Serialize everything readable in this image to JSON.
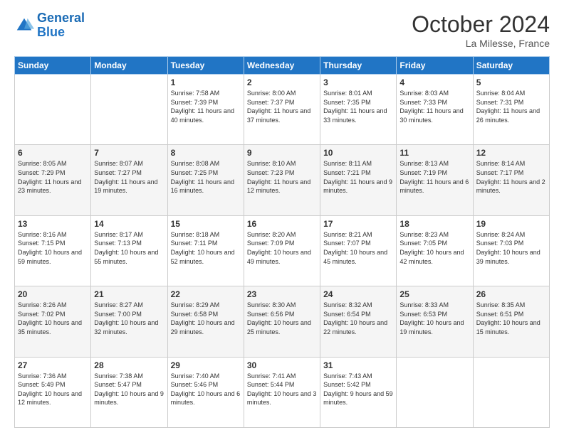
{
  "logo": {
    "line1": "General",
    "line2": "Blue"
  },
  "header": {
    "month": "October 2024",
    "location": "La Milesse, France"
  },
  "days_of_week": [
    "Sunday",
    "Monday",
    "Tuesday",
    "Wednesday",
    "Thursday",
    "Friday",
    "Saturday"
  ],
  "weeks": [
    [
      {
        "day": "",
        "sunrise": "",
        "sunset": "",
        "daylight": ""
      },
      {
        "day": "",
        "sunrise": "",
        "sunset": "",
        "daylight": ""
      },
      {
        "day": "1",
        "sunrise": "Sunrise: 7:58 AM",
        "sunset": "Sunset: 7:39 PM",
        "daylight": "Daylight: 11 hours and 40 minutes."
      },
      {
        "day": "2",
        "sunrise": "Sunrise: 8:00 AM",
        "sunset": "Sunset: 7:37 PM",
        "daylight": "Daylight: 11 hours and 37 minutes."
      },
      {
        "day": "3",
        "sunrise": "Sunrise: 8:01 AM",
        "sunset": "Sunset: 7:35 PM",
        "daylight": "Daylight: 11 hours and 33 minutes."
      },
      {
        "day": "4",
        "sunrise": "Sunrise: 8:03 AM",
        "sunset": "Sunset: 7:33 PM",
        "daylight": "Daylight: 11 hours and 30 minutes."
      },
      {
        "day": "5",
        "sunrise": "Sunrise: 8:04 AM",
        "sunset": "Sunset: 7:31 PM",
        "daylight": "Daylight: 11 hours and 26 minutes."
      }
    ],
    [
      {
        "day": "6",
        "sunrise": "Sunrise: 8:05 AM",
        "sunset": "Sunset: 7:29 PM",
        "daylight": "Daylight: 11 hours and 23 minutes."
      },
      {
        "day": "7",
        "sunrise": "Sunrise: 8:07 AM",
        "sunset": "Sunset: 7:27 PM",
        "daylight": "Daylight: 11 hours and 19 minutes."
      },
      {
        "day": "8",
        "sunrise": "Sunrise: 8:08 AM",
        "sunset": "Sunset: 7:25 PM",
        "daylight": "Daylight: 11 hours and 16 minutes."
      },
      {
        "day": "9",
        "sunrise": "Sunrise: 8:10 AM",
        "sunset": "Sunset: 7:23 PM",
        "daylight": "Daylight: 11 hours and 12 minutes."
      },
      {
        "day": "10",
        "sunrise": "Sunrise: 8:11 AM",
        "sunset": "Sunset: 7:21 PM",
        "daylight": "Daylight: 11 hours and 9 minutes."
      },
      {
        "day": "11",
        "sunrise": "Sunrise: 8:13 AM",
        "sunset": "Sunset: 7:19 PM",
        "daylight": "Daylight: 11 hours and 6 minutes."
      },
      {
        "day": "12",
        "sunrise": "Sunrise: 8:14 AM",
        "sunset": "Sunset: 7:17 PM",
        "daylight": "Daylight: 11 hours and 2 minutes."
      }
    ],
    [
      {
        "day": "13",
        "sunrise": "Sunrise: 8:16 AM",
        "sunset": "Sunset: 7:15 PM",
        "daylight": "Daylight: 10 hours and 59 minutes."
      },
      {
        "day": "14",
        "sunrise": "Sunrise: 8:17 AM",
        "sunset": "Sunset: 7:13 PM",
        "daylight": "Daylight: 10 hours and 55 minutes."
      },
      {
        "day": "15",
        "sunrise": "Sunrise: 8:18 AM",
        "sunset": "Sunset: 7:11 PM",
        "daylight": "Daylight: 10 hours and 52 minutes."
      },
      {
        "day": "16",
        "sunrise": "Sunrise: 8:20 AM",
        "sunset": "Sunset: 7:09 PM",
        "daylight": "Daylight: 10 hours and 49 minutes."
      },
      {
        "day": "17",
        "sunrise": "Sunrise: 8:21 AM",
        "sunset": "Sunset: 7:07 PM",
        "daylight": "Daylight: 10 hours and 45 minutes."
      },
      {
        "day": "18",
        "sunrise": "Sunrise: 8:23 AM",
        "sunset": "Sunset: 7:05 PM",
        "daylight": "Daylight: 10 hours and 42 minutes."
      },
      {
        "day": "19",
        "sunrise": "Sunrise: 8:24 AM",
        "sunset": "Sunset: 7:03 PM",
        "daylight": "Daylight: 10 hours and 39 minutes."
      }
    ],
    [
      {
        "day": "20",
        "sunrise": "Sunrise: 8:26 AM",
        "sunset": "Sunset: 7:02 PM",
        "daylight": "Daylight: 10 hours and 35 minutes."
      },
      {
        "day": "21",
        "sunrise": "Sunrise: 8:27 AM",
        "sunset": "Sunset: 7:00 PM",
        "daylight": "Daylight: 10 hours and 32 minutes."
      },
      {
        "day": "22",
        "sunrise": "Sunrise: 8:29 AM",
        "sunset": "Sunset: 6:58 PM",
        "daylight": "Daylight: 10 hours and 29 minutes."
      },
      {
        "day": "23",
        "sunrise": "Sunrise: 8:30 AM",
        "sunset": "Sunset: 6:56 PM",
        "daylight": "Daylight: 10 hours and 25 minutes."
      },
      {
        "day": "24",
        "sunrise": "Sunrise: 8:32 AM",
        "sunset": "Sunset: 6:54 PM",
        "daylight": "Daylight: 10 hours and 22 minutes."
      },
      {
        "day": "25",
        "sunrise": "Sunrise: 8:33 AM",
        "sunset": "Sunset: 6:53 PM",
        "daylight": "Daylight: 10 hours and 19 minutes."
      },
      {
        "day": "26",
        "sunrise": "Sunrise: 8:35 AM",
        "sunset": "Sunset: 6:51 PM",
        "daylight": "Daylight: 10 hours and 15 minutes."
      }
    ],
    [
      {
        "day": "27",
        "sunrise": "Sunrise: 7:36 AM",
        "sunset": "Sunset: 5:49 PM",
        "daylight": "Daylight: 10 hours and 12 minutes."
      },
      {
        "day": "28",
        "sunrise": "Sunrise: 7:38 AM",
        "sunset": "Sunset: 5:47 PM",
        "daylight": "Daylight: 10 hours and 9 minutes."
      },
      {
        "day": "29",
        "sunrise": "Sunrise: 7:40 AM",
        "sunset": "Sunset: 5:46 PM",
        "daylight": "Daylight: 10 hours and 6 minutes."
      },
      {
        "day": "30",
        "sunrise": "Sunrise: 7:41 AM",
        "sunset": "Sunset: 5:44 PM",
        "daylight": "Daylight: 10 hours and 3 minutes."
      },
      {
        "day": "31",
        "sunrise": "Sunrise: 7:43 AM",
        "sunset": "Sunset: 5:42 PM",
        "daylight": "Daylight: 9 hours and 59 minutes."
      },
      {
        "day": "",
        "sunrise": "",
        "sunset": "",
        "daylight": ""
      },
      {
        "day": "",
        "sunrise": "",
        "sunset": "",
        "daylight": ""
      }
    ]
  ]
}
